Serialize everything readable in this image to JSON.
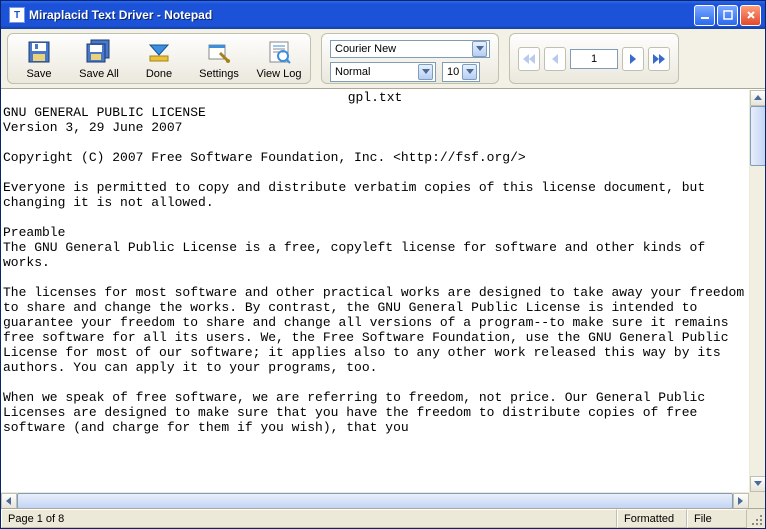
{
  "window": {
    "title": "Miraplacid Text Driver - Notepad"
  },
  "toolbar": {
    "save": "Save",
    "save_all": "Save All",
    "done": "Done",
    "settings": "Settings",
    "view_log": "View Log"
  },
  "font": {
    "family": "Courier New",
    "weight": "Normal",
    "size": "10"
  },
  "nav": {
    "page": "1"
  },
  "doc": {
    "filename": "gpl.txt",
    "body": "GNU GENERAL PUBLIC LICENSE\nVersion 3, 29 June 2007\n\nCopyright (C) 2007 Free Software Foundation, Inc. <http://fsf.org/>\n\nEveryone is permitted to copy and distribute verbatim copies of this license document, but changing it is not allowed.\n\nPreamble\nThe GNU General Public License is a free, copyleft license for software and other kinds of works.\n\nThe licenses for most software and other practical works are designed to take away your freedom to share and change the works. By contrast, the GNU General Public License is intended to guarantee your freedom to share and change all versions of a program--to make sure it remains free software for all its users. We, the Free Software Foundation, use the GNU General Public License for most of our software; it applies also to any other work released this way by its authors. You can apply it to your programs, too.\n\nWhen we speak of free software, we are referring to freedom, not price. Our General Public Licenses are designed to make sure that you have the freedom to distribute copies of free software (and charge for them if you wish), that you"
  },
  "status": {
    "page": "Page 1 of 8",
    "formatted": "Formatted",
    "file": "File"
  }
}
